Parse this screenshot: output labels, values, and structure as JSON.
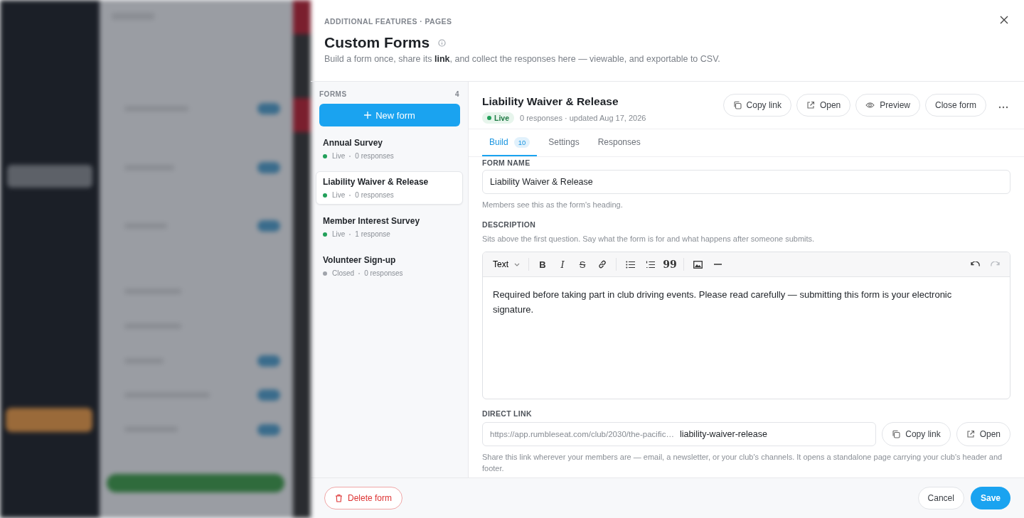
{
  "breadcrumb": "ADDITIONAL FEATURES · PAGES",
  "title": "Custom Forms",
  "subtitle": "Build a form once, share its **link**, and collect the responses here — viewable, and exportable to CSV.",
  "forms_list": {
    "heading": "FORMS",
    "count": "4",
    "new_button": "New form",
    "items": [
      {
        "name": "Annual Survey",
        "status": "Live",
        "responses": "0 responses",
        "color": "#22a05a",
        "selected": false
      },
      {
        "name": "Liability Waiver & Release",
        "status": "Live",
        "responses": "0 responses",
        "color": "#22a05a",
        "selected": true
      },
      {
        "name": "Member Interest Survey",
        "status": "Live",
        "responses": "1 response",
        "color": "#22a05a",
        "selected": false
      },
      {
        "name": "Volunteer Sign-up",
        "status": "Closed",
        "responses": "0 responses",
        "color": "#a0a4ab",
        "selected": false
      }
    ]
  },
  "form": {
    "title": "Liability Waiver & Release",
    "status": "Live",
    "meta": "0 responses · updated Aug 17, 2026",
    "actions": [
      {
        "kind": "copy",
        "label": "Copy link"
      },
      {
        "kind": "open",
        "label": "Open"
      },
      {
        "kind": "preview",
        "label": "Preview"
      },
      {
        "kind": "plain",
        "label": "Close form"
      }
    ],
    "tabs": [
      {
        "label": "Build",
        "badge": "10",
        "selected": true
      },
      {
        "label": "Settings",
        "selected": false
      },
      {
        "label": "Responses",
        "selected": false
      }
    ],
    "form_name": {
      "label": "FORM NAME",
      "value": "Liability Waiver & Release",
      "hint": "Members see this as the form's heading."
    },
    "description": {
      "label": "DESCRIPTION",
      "hint": "Sits above the first question. Say what the form is for and what happens after someone submits.",
      "format": "Text",
      "tools": [
        {
          "kind": "bold",
          "glyph": "B"
        },
        {
          "kind": "italic",
          "glyph": "I"
        },
        {
          "kind": "strike",
          "glyph": "S"
        },
        {
          "kind": "link"
        },
        {
          "kind": "sep"
        },
        {
          "kind": "bullets"
        },
        {
          "kind": "numbers"
        },
        {
          "kind": "quote",
          "glyph": "99"
        },
        {
          "kind": "sep"
        },
        {
          "kind": "image"
        },
        {
          "kind": "rule"
        }
      ],
      "undo_disabled": false,
      "redo_disabled": true,
      "content": "Required before taking part in club driving events. Please read carefully — submitting this form is your electronic signature."
    },
    "direct_link": {
      "label": "DIRECT LINK",
      "base": "https://app.rumbleseat.com/club/2030/the-pacific…",
      "slug": "liability-waiver-release",
      "actions": [
        {
          "kind": "copy",
          "label": "Copy link"
        },
        {
          "kind": "open",
          "label": "Open"
        }
      ],
      "hint": "Share this link wherever your members are — email, a newsletter, or your club's channels. It opens a standalone page carrying your club's header and footer."
    }
  },
  "footer": {
    "delete": "Delete form",
    "cancel": "Cancel",
    "save": "Save"
  }
}
